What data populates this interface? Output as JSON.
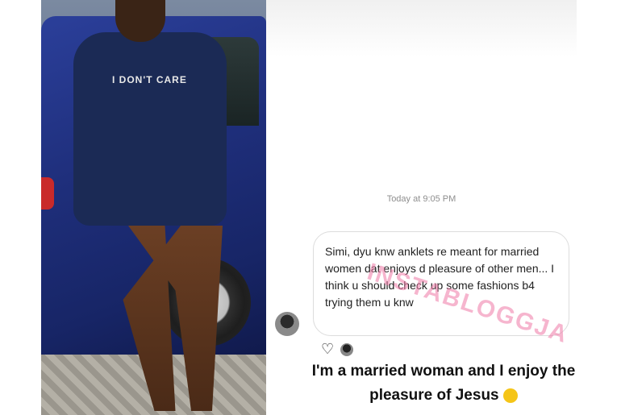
{
  "photo": {
    "shirt_text": "I DON'T CARE"
  },
  "chat": {
    "timestamp": "Today at 9:05 PM",
    "incoming_message": "Simi, dyu knw anklets re meant for married women dat enjoys d pleasure of other men... I think u should check up some fashions b4 trying them u knw",
    "reply_message": "I'm a married woman and I enjoy the pleasure of Jesus",
    "reaction_icon": "heart-icon",
    "watermark": "INSTABLOGGJA"
  },
  "colors": {
    "bubble_border": "#dcdcdc",
    "watermark": "#ef78a5"
  }
}
